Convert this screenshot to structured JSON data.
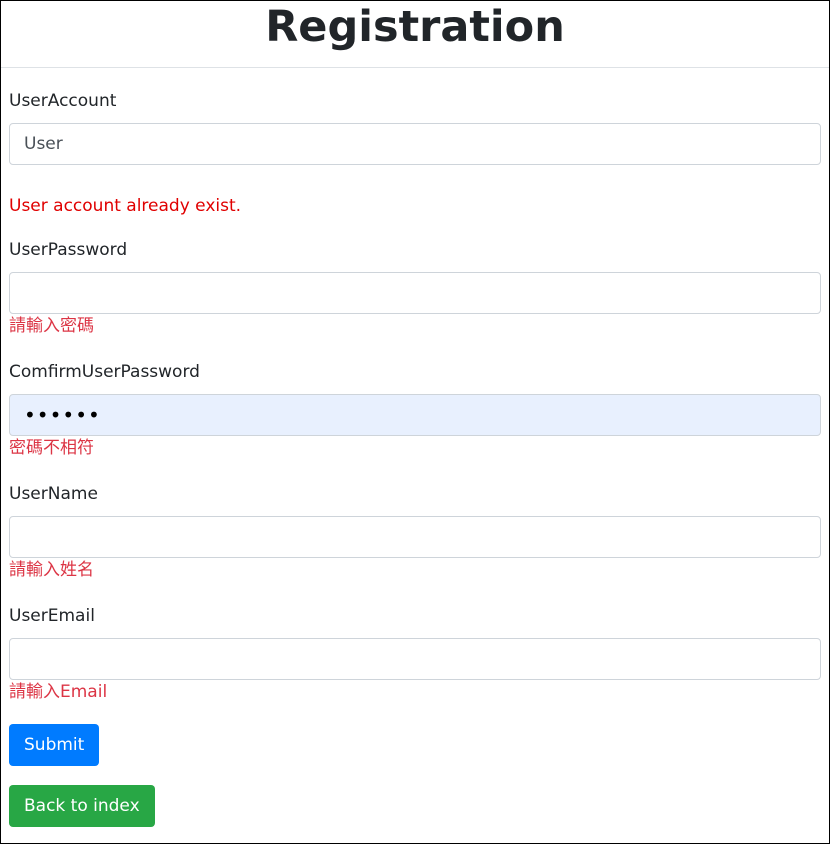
{
  "page": {
    "title": "Registration"
  },
  "form": {
    "user_account": {
      "label": "UserAccount",
      "placeholder": "User",
      "error": "User account already exist."
    },
    "user_password": {
      "label": "UserPassword",
      "value": "",
      "error": "請輸入密碼"
    },
    "confirm_password": {
      "label": "ComfirmUserPassword",
      "value": "••••••",
      "error": "密碼不相符"
    },
    "user_name": {
      "label": "UserName",
      "value": "",
      "error": "請輸入姓名"
    },
    "user_email": {
      "label": "UserEmail",
      "value": "",
      "error": "請輸入Email"
    }
  },
  "buttons": {
    "submit": "Submit",
    "back": "Back to index"
  },
  "colors": {
    "primary": "#007bff",
    "success": "#28a745",
    "error": "#dc3545",
    "autofill_bg": "#e8f0fe"
  }
}
